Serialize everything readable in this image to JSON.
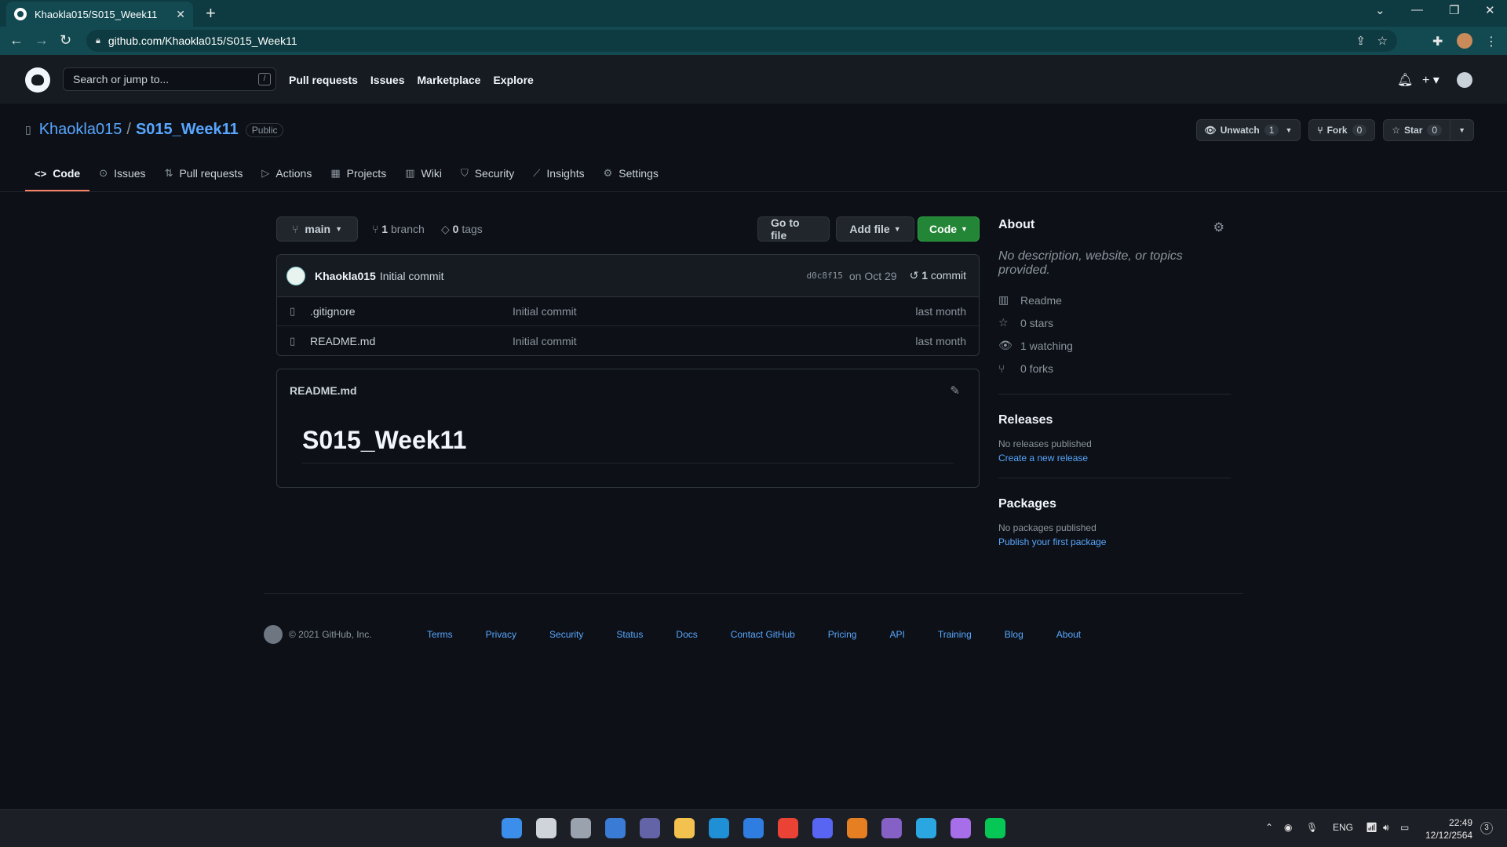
{
  "browser": {
    "tab_title": "Khaokla015/S015_Week11",
    "tab_close": "✕",
    "new_tab": "+",
    "url": "github.com/Khaokla015/S015_Week11"
  },
  "github_header": {
    "search_placeholder": "Search or jump to...",
    "search_shortcut": "/",
    "nav": [
      "Pull requests",
      "Issues",
      "Marketplace",
      "Explore"
    ]
  },
  "repo": {
    "owner": "Khaokla015",
    "separator": "/",
    "name": "S015_Week11",
    "visibility": "Public",
    "unwatch_label": "Unwatch",
    "watch_count": "1",
    "fork_label": "Fork",
    "fork_count": "0",
    "star_label": "Star",
    "star_count": "0",
    "tabs": [
      "Code",
      "Issues",
      "Pull requests",
      "Actions",
      "Projects",
      "Wiki",
      "Security",
      "Insights",
      "Settings"
    ]
  },
  "toolbar": {
    "branch": "main",
    "branch_count": "1",
    "branch_word": "branch",
    "tag_count": "0",
    "tag_word": "tags",
    "go_to_file": "Go to file",
    "add_file": "Add file",
    "code": "Code"
  },
  "commit": {
    "author": "Khaokla015",
    "message": "Initial commit",
    "sha": "d0c8f15",
    "date": "on Oct 29",
    "count": "1",
    "count_word": "commit"
  },
  "files": [
    {
      "name": ".gitignore",
      "message": "Initial commit",
      "age": "last month"
    },
    {
      "name": "README.md",
      "message": "Initial commit",
      "age": "last month"
    }
  ],
  "readme": {
    "filename": "README.md",
    "heading": "S015_Week11"
  },
  "about": {
    "title": "About",
    "description": "No description, website, or topics provided.",
    "readme": "Readme",
    "stars": "0 stars",
    "watching": "1 watching",
    "forks": "0 forks"
  },
  "releases": {
    "title": "Releases",
    "empty": "No releases published",
    "link": "Create a new release"
  },
  "packages": {
    "title": "Packages",
    "empty": "No packages published",
    "link": "Publish your first package"
  },
  "footer": {
    "copyright": "© 2021 GitHub, Inc.",
    "links": [
      "Terms",
      "Privacy",
      "Security",
      "Status",
      "Docs",
      "Contact GitHub",
      "Pricing",
      "API",
      "Training",
      "Blog",
      "About"
    ]
  },
  "taskbar": {
    "lang": "ENG",
    "time": "22:49",
    "date": "12/12/2564",
    "notification_count": "3",
    "app_colors": [
      "#3b8eea",
      "#cfd3da",
      "#9aa3ad",
      "#3a7bd5",
      "#6264a7",
      "#f2c14e",
      "#1f8fd6",
      "#2f7de1",
      "#ea4335",
      "#5865f2",
      "#e67e22",
      "#8661c5",
      "#2aa7e0",
      "#a66ee8",
      "#06c755"
    ]
  },
  "colors": {
    "link": "#58a6ff",
    "green_button": "#238636",
    "active_tab_underline": "#f78166"
  }
}
